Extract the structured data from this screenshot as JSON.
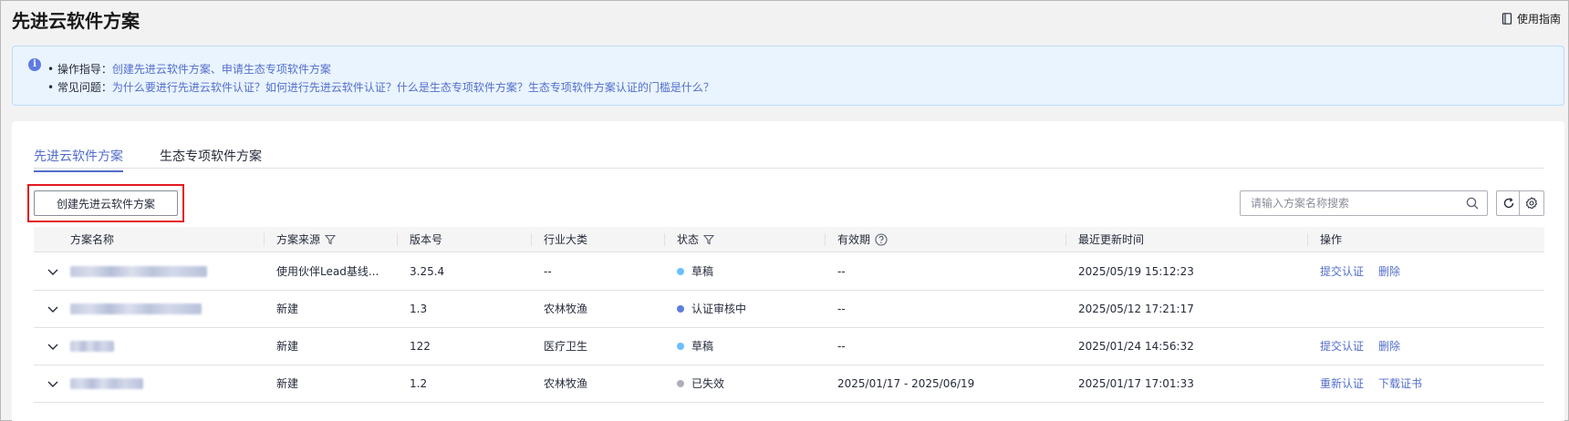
{
  "page": {
    "title": "先进云软件方案",
    "guide_label": "使用指南"
  },
  "info": {
    "line1_label": "• 操作指导：",
    "line1_link": "创建先进云软件方案、申请生态专项软件方案",
    "line2_label": "• 常见问题：",
    "line2_link": "为什么要进行先进云软件认证？如何进行先进云软件认证？什么是生态专项软件方案？生态专项软件方案认证的门槛是什么？"
  },
  "tabs": [
    {
      "label": "先进云软件方案",
      "active": true
    },
    {
      "label": "生态专项软件方案",
      "active": false
    }
  ],
  "toolbar": {
    "create_label": "创建先进云软件方案",
    "search_placeholder": "请输入方案名称搜索"
  },
  "table": {
    "columns": [
      "方案名称",
      "方案来源",
      "版本号",
      "行业大类",
      "状态",
      "有效期",
      "最近更新时间",
      "操作"
    ],
    "rows": [
      {
        "source": "使用伙伴Lead基线...",
        "version": "3.25.4",
        "industry": "--",
        "status": "草稿",
        "status_color": "#6cbfff",
        "validity": "--",
        "updated": "2025/05/19 15:12:23",
        "actions": [
          "提交认证",
          "删除"
        ]
      },
      {
        "source": "新建",
        "version": "1.3",
        "industry": "农林牧渔",
        "status": "认证审核中",
        "status_color": "#5e7ce0",
        "validity": "--",
        "updated": "2025/05/12 17:21:17",
        "actions": []
      },
      {
        "source": "新建",
        "version": "122",
        "industry": "医疗卫生",
        "status": "草稿",
        "status_color": "#6cbfff",
        "validity": "--",
        "updated": "2025/01/24 14:56:32",
        "actions": [
          "提交认证",
          "删除"
        ]
      },
      {
        "source": "新建",
        "version": "1.2",
        "industry": "农林牧渔",
        "status": "已失效",
        "status_color": "#adb0b8",
        "validity": "2025/01/17 - 2025/06/19",
        "updated": "2025/01/17 17:01:33",
        "actions": [
          "重新认证",
          "下载证书"
        ]
      }
    ]
  }
}
